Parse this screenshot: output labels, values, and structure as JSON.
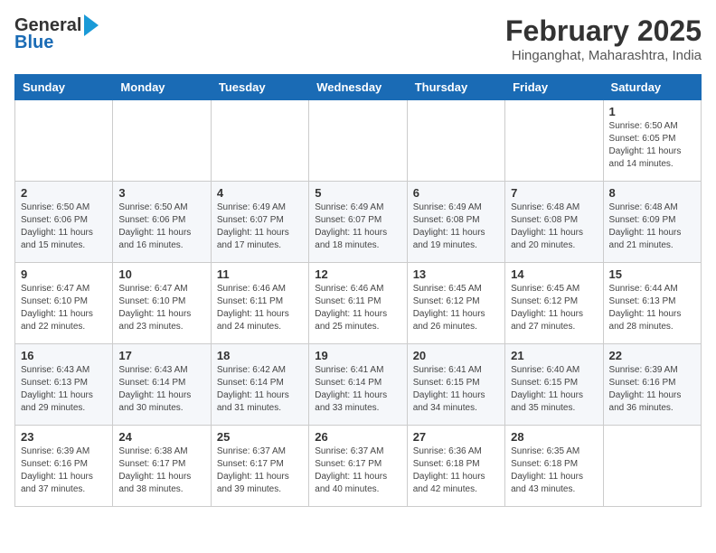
{
  "header": {
    "logo_line1": "General",
    "logo_line2": "Blue",
    "title": "February 2025",
    "subtitle": "Hinganghat, Maharashtra, India"
  },
  "days_of_week": [
    "Sunday",
    "Monday",
    "Tuesday",
    "Wednesday",
    "Thursday",
    "Friday",
    "Saturday"
  ],
  "weeks": [
    [
      {
        "day": "",
        "info": ""
      },
      {
        "day": "",
        "info": ""
      },
      {
        "day": "",
        "info": ""
      },
      {
        "day": "",
        "info": ""
      },
      {
        "day": "",
        "info": ""
      },
      {
        "day": "",
        "info": ""
      },
      {
        "day": "1",
        "info": "Sunrise: 6:50 AM\nSunset: 6:05 PM\nDaylight: 11 hours\nand 14 minutes."
      }
    ],
    [
      {
        "day": "2",
        "info": "Sunrise: 6:50 AM\nSunset: 6:06 PM\nDaylight: 11 hours\nand 15 minutes."
      },
      {
        "day": "3",
        "info": "Sunrise: 6:50 AM\nSunset: 6:06 PM\nDaylight: 11 hours\nand 16 minutes."
      },
      {
        "day": "4",
        "info": "Sunrise: 6:49 AM\nSunset: 6:07 PM\nDaylight: 11 hours\nand 17 minutes."
      },
      {
        "day": "5",
        "info": "Sunrise: 6:49 AM\nSunset: 6:07 PM\nDaylight: 11 hours\nand 18 minutes."
      },
      {
        "day": "6",
        "info": "Sunrise: 6:49 AM\nSunset: 6:08 PM\nDaylight: 11 hours\nand 19 minutes."
      },
      {
        "day": "7",
        "info": "Sunrise: 6:48 AM\nSunset: 6:08 PM\nDaylight: 11 hours\nand 20 minutes."
      },
      {
        "day": "8",
        "info": "Sunrise: 6:48 AM\nSunset: 6:09 PM\nDaylight: 11 hours\nand 21 minutes."
      }
    ],
    [
      {
        "day": "9",
        "info": "Sunrise: 6:47 AM\nSunset: 6:10 PM\nDaylight: 11 hours\nand 22 minutes."
      },
      {
        "day": "10",
        "info": "Sunrise: 6:47 AM\nSunset: 6:10 PM\nDaylight: 11 hours\nand 23 minutes."
      },
      {
        "day": "11",
        "info": "Sunrise: 6:46 AM\nSunset: 6:11 PM\nDaylight: 11 hours\nand 24 minutes."
      },
      {
        "day": "12",
        "info": "Sunrise: 6:46 AM\nSunset: 6:11 PM\nDaylight: 11 hours\nand 25 minutes."
      },
      {
        "day": "13",
        "info": "Sunrise: 6:45 AM\nSunset: 6:12 PM\nDaylight: 11 hours\nand 26 minutes."
      },
      {
        "day": "14",
        "info": "Sunrise: 6:45 AM\nSunset: 6:12 PM\nDaylight: 11 hours\nand 27 minutes."
      },
      {
        "day": "15",
        "info": "Sunrise: 6:44 AM\nSunset: 6:13 PM\nDaylight: 11 hours\nand 28 minutes."
      }
    ],
    [
      {
        "day": "16",
        "info": "Sunrise: 6:43 AM\nSunset: 6:13 PM\nDaylight: 11 hours\nand 29 minutes."
      },
      {
        "day": "17",
        "info": "Sunrise: 6:43 AM\nSunset: 6:14 PM\nDaylight: 11 hours\nand 30 minutes."
      },
      {
        "day": "18",
        "info": "Sunrise: 6:42 AM\nSunset: 6:14 PM\nDaylight: 11 hours\nand 31 minutes."
      },
      {
        "day": "19",
        "info": "Sunrise: 6:41 AM\nSunset: 6:14 PM\nDaylight: 11 hours\nand 33 minutes."
      },
      {
        "day": "20",
        "info": "Sunrise: 6:41 AM\nSunset: 6:15 PM\nDaylight: 11 hours\nand 34 minutes."
      },
      {
        "day": "21",
        "info": "Sunrise: 6:40 AM\nSunset: 6:15 PM\nDaylight: 11 hours\nand 35 minutes."
      },
      {
        "day": "22",
        "info": "Sunrise: 6:39 AM\nSunset: 6:16 PM\nDaylight: 11 hours\nand 36 minutes."
      }
    ],
    [
      {
        "day": "23",
        "info": "Sunrise: 6:39 AM\nSunset: 6:16 PM\nDaylight: 11 hours\nand 37 minutes."
      },
      {
        "day": "24",
        "info": "Sunrise: 6:38 AM\nSunset: 6:17 PM\nDaylight: 11 hours\nand 38 minutes."
      },
      {
        "day": "25",
        "info": "Sunrise: 6:37 AM\nSunset: 6:17 PM\nDaylight: 11 hours\nand 39 minutes."
      },
      {
        "day": "26",
        "info": "Sunrise: 6:37 AM\nSunset: 6:17 PM\nDaylight: 11 hours\nand 40 minutes."
      },
      {
        "day": "27",
        "info": "Sunrise: 6:36 AM\nSunset: 6:18 PM\nDaylight: 11 hours\nand 42 minutes."
      },
      {
        "day": "28",
        "info": "Sunrise: 6:35 AM\nSunset: 6:18 PM\nDaylight: 11 hours\nand 43 minutes."
      },
      {
        "day": "",
        "info": ""
      }
    ]
  ]
}
